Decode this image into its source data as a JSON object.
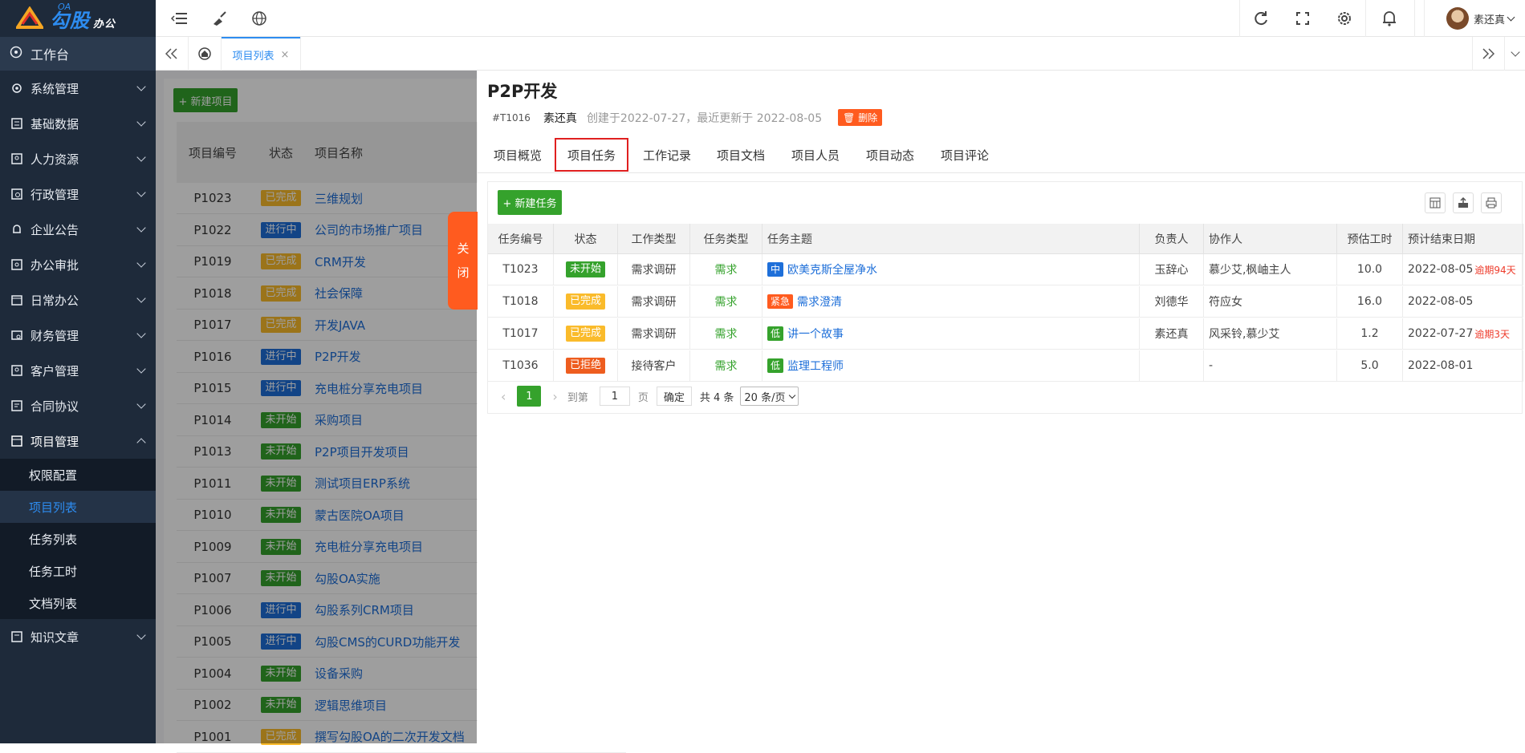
{
  "app": {
    "brand": "勾股",
    "brand_sub": "办公",
    "brand_oa": "OA"
  },
  "header": {
    "user_name": "素还真"
  },
  "sidebar": {
    "workbench": "工作台",
    "items": [
      {
        "label": "系统管理",
        "icon": "gear-icon"
      },
      {
        "label": "基础数据",
        "icon": "database-icon"
      },
      {
        "label": "人力资源",
        "icon": "user-icon"
      },
      {
        "label": "行政管理",
        "icon": "building-icon"
      },
      {
        "label": "企业公告",
        "icon": "bell-icon"
      },
      {
        "label": "办公审批",
        "icon": "approve-icon"
      },
      {
        "label": "日常办公",
        "icon": "calendar-icon"
      },
      {
        "label": "财务管理",
        "icon": "money-icon"
      },
      {
        "label": "客户管理",
        "icon": "customer-icon"
      },
      {
        "label": "合同协议",
        "icon": "contract-icon"
      },
      {
        "label": "项目管理",
        "icon": "project-icon"
      }
    ],
    "sub_items": [
      "权限配置",
      "项目列表",
      "任务列表",
      "任务工时",
      "文档列表"
    ],
    "last_item": "知识文章"
  },
  "tabs": {
    "current": "项目列表",
    "close": "×"
  },
  "list": {
    "new_button": "+ 新建项目",
    "col_code": "项目编号",
    "col_status": "状态",
    "col_name": "项目名称",
    "rows": [
      {
        "code": "P1023",
        "status": "已完成",
        "kind": "done",
        "name": "三维规划"
      },
      {
        "code": "P1022",
        "status": "进行中",
        "kind": "doing",
        "name": "公司的市场推广项目"
      },
      {
        "code": "P1019",
        "status": "已完成",
        "kind": "done",
        "name": "CRM开发"
      },
      {
        "code": "P1018",
        "status": "已完成",
        "kind": "done",
        "name": "社会保障"
      },
      {
        "code": "P1017",
        "status": "已完成",
        "kind": "done",
        "name": "开发JAVA"
      },
      {
        "code": "P1016",
        "status": "进行中",
        "kind": "doing",
        "name": "P2P开发"
      },
      {
        "code": "P1015",
        "status": "进行中",
        "kind": "doing",
        "name": "充电桩分享充电项目"
      },
      {
        "code": "P1014",
        "status": "未开始",
        "kind": "not",
        "name": "采购项目"
      },
      {
        "code": "P1013",
        "status": "未开始",
        "kind": "not",
        "name": "P2P项目开发项目"
      },
      {
        "code": "P1011",
        "status": "未开始",
        "kind": "not",
        "name": "测试项目ERP系统"
      },
      {
        "code": "P1010",
        "status": "未开始",
        "kind": "not",
        "name": "蒙古医院OA项目"
      },
      {
        "code": "P1009",
        "status": "未开始",
        "kind": "not",
        "name": "充电桩分享充电项目"
      },
      {
        "code": "P1007",
        "status": "未开始",
        "kind": "not",
        "name": "勾股OA实施"
      },
      {
        "code": "P1006",
        "status": "进行中",
        "kind": "doing",
        "name": "勾股系列CRM项目"
      },
      {
        "code": "P1005",
        "status": "进行中",
        "kind": "doing",
        "name": "勾股CMS的CURD功能开发"
      },
      {
        "code": "P1004",
        "status": "未开始",
        "kind": "not",
        "name": "设备采购"
      },
      {
        "code": "P1002",
        "status": "未开始",
        "kind": "not",
        "name": "逻辑思维项目"
      },
      {
        "code": "P1001",
        "status": "已完成",
        "kind": "done",
        "name": "撰写勾股OA的二次开发文档"
      }
    ]
  },
  "close_tab": {
    "line1": "关",
    "line2": "闭"
  },
  "drawer": {
    "title": "P2P开发",
    "task_id": "#T1016",
    "owner": "素还真",
    "info": "创建于2022-07-27，最近更新于 2022-08-05",
    "delete_label": "删除",
    "tabs": [
      "项目概览",
      "项目任务",
      "工作记录",
      "项目文档",
      "项目人员",
      "项目动态",
      "项目评论"
    ],
    "new_task": "+ 新建任务",
    "columns": [
      "任务编号",
      "状态",
      "工作类型",
      "任务类型",
      "任务主题",
      "负责人",
      "协作人",
      "预估工时",
      "预计结束日期"
    ],
    "rows": [
      {
        "id": "T1023",
        "status": "未开始",
        "kind": "not",
        "work": "需求调研",
        "type": "需求",
        "pri": "中",
        "pri_kind": "mid",
        "topic": "欧美克斯全屋净水",
        "owner": "玉辞心",
        "helpers": "慕少艾,枫岫主人",
        "hours": "10.0",
        "date": "2022-08-05",
        "overdue": "逾期94天"
      },
      {
        "id": "T1018",
        "status": "已完成",
        "kind": "done",
        "work": "需求调研",
        "type": "需求",
        "pri": "紧急",
        "pri_kind": "urg",
        "topic": "需求澄清",
        "owner": "刘德华",
        "helpers": "符应女",
        "hours": "16.0",
        "date": "2022-08-05",
        "overdue": ""
      },
      {
        "id": "T1017",
        "status": "已完成",
        "kind": "done",
        "work": "需求调研",
        "type": "需求",
        "pri": "低",
        "pri_kind": "low",
        "topic": "讲一个故事",
        "owner": "素还真",
        "helpers": "风采铃,慕少艾",
        "hours": "1.2",
        "date": "2022-07-27",
        "overdue": "逾期3天"
      },
      {
        "id": "T1036",
        "status": "已拒绝",
        "kind": "reject",
        "work": "接待客户",
        "type": "需求",
        "pri": "低",
        "pri_kind": "low",
        "topic": "监理工程师",
        "owner": "",
        "helpers": "-",
        "hours": "5.0",
        "date": "2022-08-01",
        "overdue": ""
      }
    ],
    "pager": {
      "page": "1",
      "goto_label": "到第",
      "goto_value": "1",
      "page_unit": "页",
      "confirm": "确定",
      "total": "共 4 条",
      "per_page": "20 条/页"
    }
  }
}
